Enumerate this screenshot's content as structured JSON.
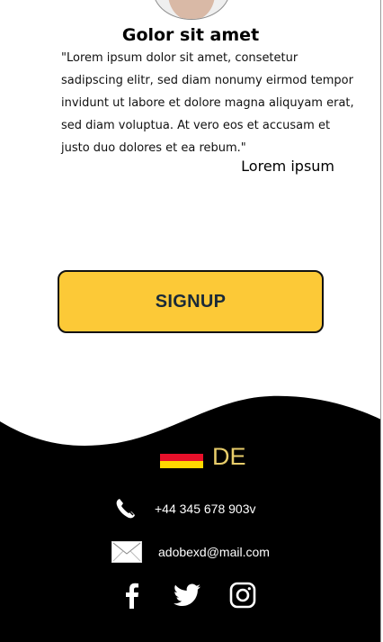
{
  "testimonial": {
    "name": "Golor sit amet",
    "quote": "\"Lorem ipsum dolor sit amet, consetetur sadipscing elitr, sed diam nonumy eirmod tempor invidunt ut labore et dolore magna aliquyam erat, sed diam voluptua. At vero eos et accusam et justo duo dolores et ea rebum.\"",
    "author": "Lorem ipsum"
  },
  "cta": {
    "signup_label": "SIGNUP"
  },
  "footer": {
    "language": {
      "code": "DE",
      "flag_colors": [
        "#000000",
        "#e8102a",
        "#ffd800"
      ]
    },
    "phone": "+44 345 678 903v",
    "email": "adobexd@mail.com",
    "socials": [
      "facebook-icon",
      "twitter-icon",
      "instagram-icon"
    ]
  },
  "colors": {
    "accent": "#fcc937",
    "footer_bg": "#000000",
    "lang_text": "#e8cd6a"
  }
}
